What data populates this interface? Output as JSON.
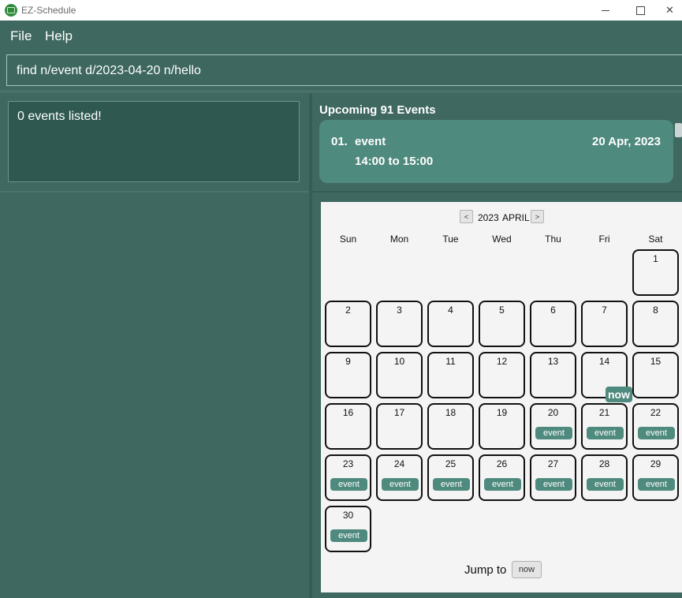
{
  "window": {
    "title": "EZ-Schedule",
    "icon": "calendar-app-icon"
  },
  "menu": {
    "file": "File",
    "help": "Help"
  },
  "command": {
    "value": "find n/event d/2023-04-20 n/hello"
  },
  "result": {
    "text": "0 events listed!"
  },
  "upcoming": {
    "title": "Upcoming 91 Events",
    "events": [
      {
        "index": "01.",
        "name": "event",
        "date": "20 Apr, 2023",
        "time": "14:00 to 15:00"
      }
    ]
  },
  "calendar": {
    "prev_label": "<",
    "next_label": ">",
    "year": "2023",
    "month": "APRIL",
    "weekdays": [
      "Sun",
      "Mon",
      "Tue",
      "Wed",
      "Thu",
      "Fri",
      "Sat"
    ],
    "first_weekday_index": 6,
    "days": [
      {
        "day": "1",
        "event": ""
      },
      {
        "day": "2",
        "event": ""
      },
      {
        "day": "3",
        "event": ""
      },
      {
        "day": "4",
        "event": ""
      },
      {
        "day": "5",
        "event": ""
      },
      {
        "day": "6",
        "event": ""
      },
      {
        "day": "7",
        "event": ""
      },
      {
        "day": "8",
        "event": ""
      },
      {
        "day": "9",
        "event": ""
      },
      {
        "day": "10",
        "event": ""
      },
      {
        "day": "11",
        "event": ""
      },
      {
        "day": "12",
        "event": ""
      },
      {
        "day": "13",
        "event": ""
      },
      {
        "day": "14",
        "event": ""
      },
      {
        "day": "15",
        "event": ""
      },
      {
        "day": "16",
        "event": ""
      },
      {
        "day": "17",
        "event": ""
      },
      {
        "day": "18",
        "event": ""
      },
      {
        "day": "19",
        "event": ""
      },
      {
        "day": "20",
        "event": "event"
      },
      {
        "day": "21",
        "event": "event"
      },
      {
        "day": "22",
        "event": "event"
      },
      {
        "day": "23",
        "event": "event"
      },
      {
        "day": "24",
        "event": "event"
      },
      {
        "day": "25",
        "event": "event"
      },
      {
        "day": "26",
        "event": "event"
      },
      {
        "day": "27",
        "event": "event"
      },
      {
        "day": "28",
        "event": "event"
      },
      {
        "day": "29",
        "event": "event"
      },
      {
        "day": "30",
        "event": "event"
      }
    ],
    "now_label": "now",
    "jump_label": "Jump to",
    "jump_button": "now"
  },
  "colors": {
    "background": "#3f6860",
    "accent": "#4f8a7e",
    "result_box": "#2f5850",
    "calendar_bg": "#f4f4f4"
  }
}
